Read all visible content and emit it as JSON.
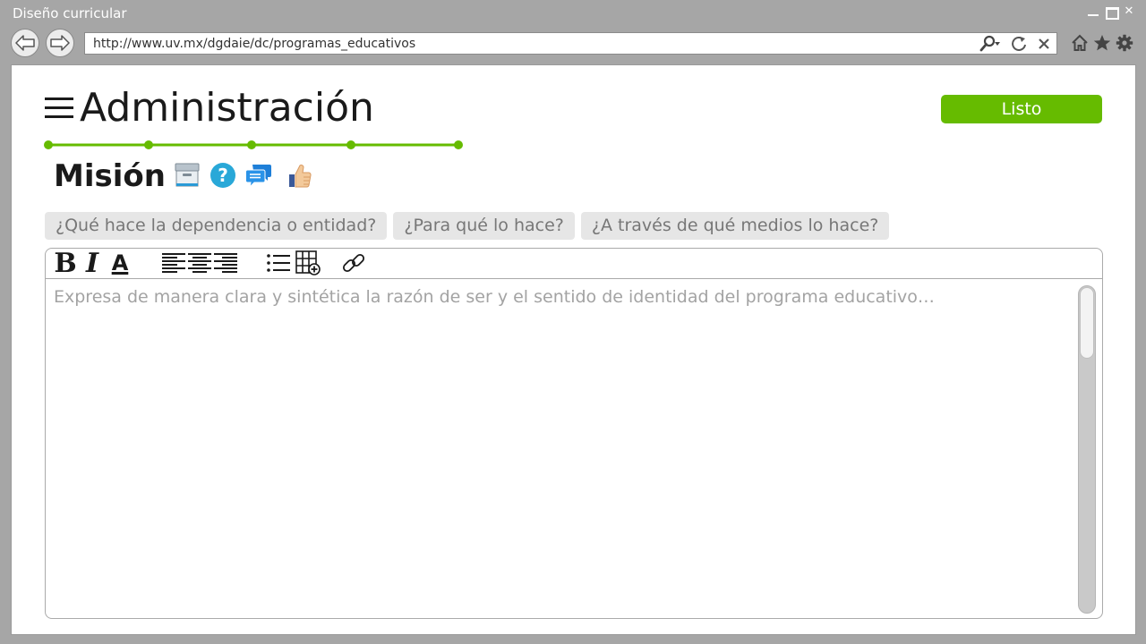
{
  "window": {
    "title": "Diseño curricular",
    "controls": [
      "minimize",
      "maximize",
      "close"
    ],
    "close_glyph": "✕"
  },
  "browser": {
    "url": "http://www.uv.mx/dgdaie/dc/programas_educativos",
    "nav_icons": [
      "back-arrow-icon",
      "forward-arrow-icon"
    ],
    "url_icons": [
      "search-icon",
      "refresh-icon",
      "close-icon"
    ],
    "right_icons": [
      "home-icon",
      "star-icon",
      "gear-icon"
    ]
  },
  "header": {
    "title": "Administración",
    "done_label": "Listo"
  },
  "stepper": {
    "steps": 5,
    "color": "#66bb00"
  },
  "section": {
    "title": "Misión",
    "icons": [
      "archive-box-icon",
      "help-icon",
      "chat-bubbles-icon",
      "thumbs-up-icon"
    ]
  },
  "prompts": [
    "¿Qué hace la dependencia o entidad?",
    "¿Para qué lo hace?",
    "¿A través de qué medios lo hace?"
  ],
  "editor": {
    "toolbar": {
      "bold": "B",
      "italic": "I",
      "font_color": "A"
    },
    "placeholder": "Expresa de manera clara y sintética la razón de ser y el sentido de identidad del programa educativo…",
    "scroll_fraction": 0.0
  },
  "colors": {
    "accent": "#66bb00",
    "chrome": "#a6a6a6",
    "help_blue": "#29a8d8",
    "chat_blue": "#1e7fd8"
  }
}
